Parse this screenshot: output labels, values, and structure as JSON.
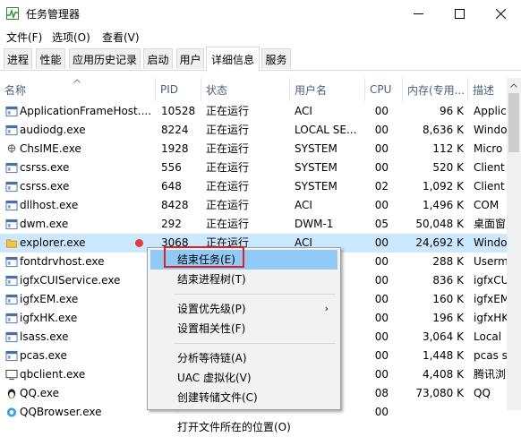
{
  "window": {
    "title": "任务管理器"
  },
  "menu": [
    "文件(F)",
    "选项(O)",
    "查看(V)"
  ],
  "tabs": [
    "进程",
    "性能",
    "应用历史记录",
    "启动",
    "用户",
    "详细信息",
    "服务"
  ],
  "active_tab": "详细信息",
  "columns": {
    "name": "名称",
    "pid": "PID",
    "status": "状态",
    "user": "用户名",
    "cpu": "CPU",
    "mem": "内存(专用...",
    "desc": "描述"
  },
  "rows": [
    {
      "name": "ApplicationFrameHost....",
      "pid": "10528",
      "status": "正在运行",
      "user": "ACI",
      "cpu": "00",
      "mem": "96 K",
      "desc": "Applic",
      "icon": "app-window-icon"
    },
    {
      "name": "audiodg.exe",
      "pid": "8224",
      "status": "正在运行",
      "user": "LOCAL SE...",
      "cpu": "00",
      "mem": "8,636 K",
      "desc": "Windo",
      "icon": "app-window-icon"
    },
    {
      "name": "ChsIME.exe",
      "pid": "1928",
      "status": "正在运行",
      "user": "SYSTEM",
      "cpu": "00",
      "mem": "112 K",
      "desc": "Micro",
      "icon": "ime-icon"
    },
    {
      "name": "csrss.exe",
      "pid": "556",
      "status": "正在运行",
      "user": "SYSTEM",
      "cpu": "00",
      "mem": "520 K",
      "desc": "Client",
      "icon": "app-window-icon"
    },
    {
      "name": "csrss.exe",
      "pid": "648",
      "status": "正在运行",
      "user": "SYSTEM",
      "cpu": "02",
      "mem": "1,092 K",
      "desc": "Client",
      "icon": "app-window-icon"
    },
    {
      "name": "dllhost.exe",
      "pid": "8428",
      "status": "正在运行",
      "user": "ACI",
      "cpu": "00",
      "mem": "1,496 K",
      "desc": "COM",
      "icon": "app-window-icon"
    },
    {
      "name": "dwm.exe",
      "pid": "292",
      "status": "正在运行",
      "user": "DWM-1",
      "cpu": "05",
      "mem": "50,048 K",
      "desc": "桌面窗",
      "icon": "app-window-icon"
    },
    {
      "name": "explorer.exe",
      "pid": "3068",
      "status": "正在运行",
      "user": "ACI",
      "cpu": "00",
      "mem": "24,692 K",
      "desc": "Windo",
      "icon": "folder-icon",
      "selected": true
    },
    {
      "name": "fontdrvhost.exe",
      "pid": "",
      "status": "",
      "user": "",
      "cpu": "00",
      "mem": "288 K",
      "desc": "Userm",
      "icon": "app-window-icon"
    },
    {
      "name": "igfxCUIService.exe",
      "pid": "",
      "status": "",
      "user": "",
      "cpu": "00",
      "mem": "836 K",
      "desc": "igfxCU",
      "icon": "app-window-icon"
    },
    {
      "name": "igfxEM.exe",
      "pid": "",
      "status": "",
      "user": "",
      "cpu": "00",
      "mem": "160 K",
      "desc": "igfxEM",
      "icon": "app-window-icon"
    },
    {
      "name": "igfxHK.exe",
      "pid": "",
      "status": "",
      "user": "",
      "cpu": "00",
      "mem": "196 K",
      "desc": "igfxHK",
      "icon": "app-window-icon"
    },
    {
      "name": "lsass.exe",
      "pid": "",
      "status": "",
      "user": "",
      "cpu": "00",
      "mem": "3,064 K",
      "desc": "Local",
      "icon": "app-window-icon"
    },
    {
      "name": "pcas.exe",
      "pid": "",
      "status": "",
      "user": "",
      "cpu": "00",
      "mem": "1,448 K",
      "desc": "pcas se",
      "icon": "app-window-icon"
    },
    {
      "name": "qbclient.exe",
      "pid": "",
      "status": "",
      "user": "",
      "cpu": "00",
      "mem": "4,408 K",
      "desc": "腾讯浏",
      "icon": "monitor-icon"
    },
    {
      "name": "QQ.exe",
      "pid": "",
      "status": "",
      "user": "",
      "cpu": "08",
      "mem": "73,080 K",
      "desc": "QQ",
      "icon": "qq-penguin-icon"
    },
    {
      "name": "QQBrowser.exe",
      "pid": "",
      "status": "",
      "user": "",
      "cpu": "00",
      "mem": "",
      "desc": "",
      "icon": "browser-icon"
    }
  ],
  "context_menu": {
    "items": [
      {
        "label": "结束任务(E)",
        "highlighted": true
      },
      {
        "label": "结束进程树(T)"
      },
      {
        "sep": true
      },
      {
        "label": "设置优先级(P)",
        "submenu": true
      },
      {
        "label": "设置相关性(F)"
      },
      {
        "sep": true
      },
      {
        "label": "分析等待链(A)"
      },
      {
        "label": "UAC 虚拟化(V)"
      },
      {
        "label": "创建转储文件(C)"
      },
      {
        "sep": true
      },
      {
        "label": "打开文件所在的位置(O)"
      }
    ]
  },
  "colors": {
    "selected_row": "#cce8ff",
    "menu_highlight": "#91c9f7",
    "annotation_box": "#e02020"
  }
}
